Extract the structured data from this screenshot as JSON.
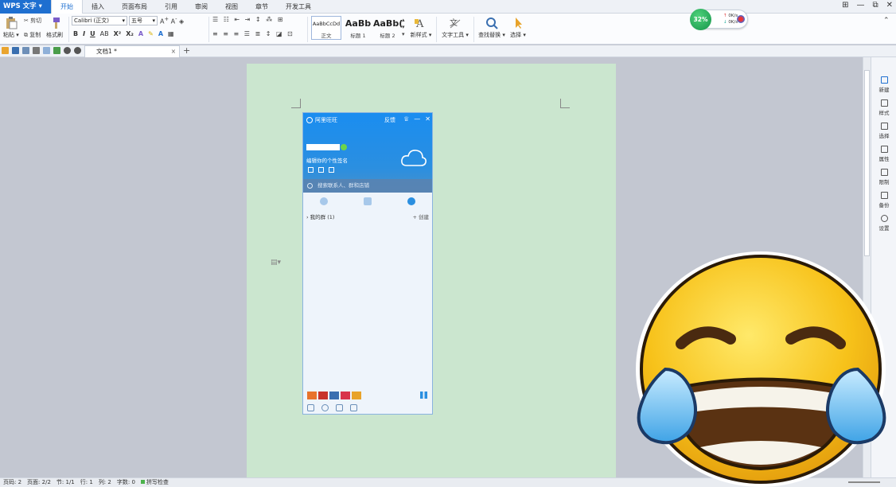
{
  "app": {
    "title": "WPS 文字"
  },
  "menu": {
    "tabs": [
      "开始",
      "插入",
      "页面布局",
      "引用",
      "审阅",
      "视图",
      "章节",
      "开发工具"
    ],
    "active": "开始"
  },
  "window_controls": [
    "⊞",
    "—",
    "⧉",
    "✕"
  ],
  "ribbon": {
    "paste_label": "粘贴",
    "cut_label": "剪切",
    "copy_label": "复制",
    "format_painter_label": "格式刷",
    "font_name": "Calibri (正文)",
    "font_size": "五号",
    "styles": [
      {
        "preview": "AaBbCcDd",
        "label": "正文"
      },
      {
        "preview": "AaBb",
        "label": "标题 1"
      },
      {
        "preview": "AaBb(",
        "label": "标题 2"
      }
    ],
    "new_style_label": "新样式",
    "text_tools_label": "文字工具",
    "find_replace_label": "查找替换",
    "select_label": "选择"
  },
  "document_tab": {
    "name": "文档1 *",
    "close": "×",
    "new": "+"
  },
  "network_widget": {
    "percent": "32%",
    "up": "0K/s",
    "down": "0K/s"
  },
  "aliwangwang": {
    "title": "阿里旺旺",
    "feedback": "反馈",
    "signature": "编辑你的个性签名",
    "search_placeholder": "搜索联系人、群和店铺",
    "group_label": "我的群 (1)",
    "create_label": "+ 创建"
  },
  "right_panel": [
    "新建",
    "样式",
    "选择",
    "属性",
    "限制",
    "备份",
    "设置"
  ],
  "status_bar": {
    "items": [
      "页码: 2",
      "页面: 2/2",
      "节: 1/1",
      "行: 1",
      "列: 2",
      "字数: 0"
    ],
    "spellcheck": "拼写检查"
  },
  "colors": {
    "accent": "#1e6fd0",
    "page": "#cbe6cf",
    "workspace": "#c3c7d1",
    "aw_header": "#1a8df0"
  }
}
